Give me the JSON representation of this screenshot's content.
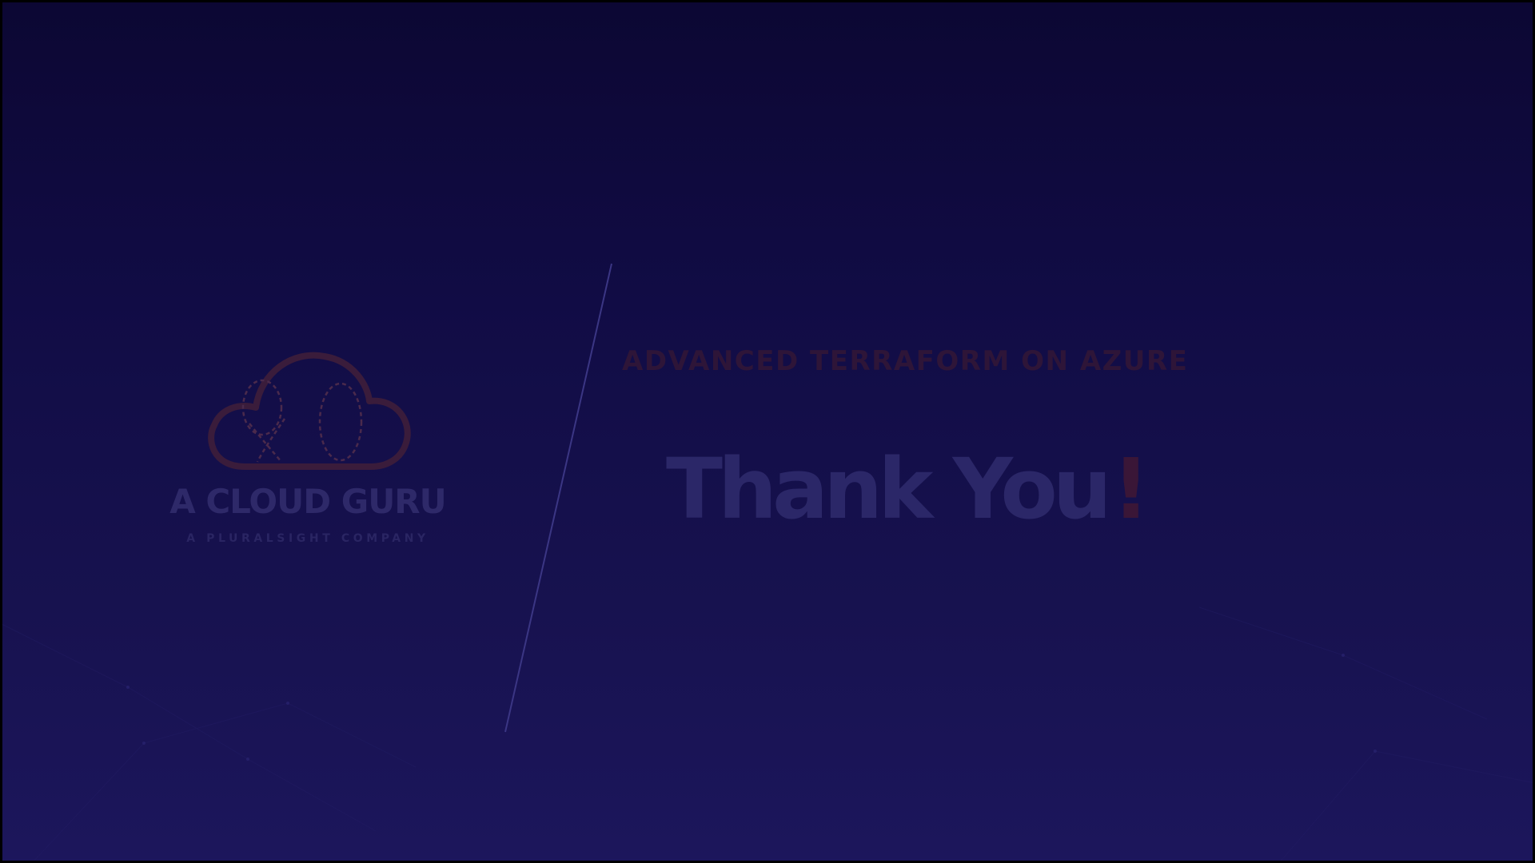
{
  "slide": {
    "course_title": "ADVANCED TERRAFORM ON AZURE",
    "message": "Thank You",
    "message_punctuation": "!"
  },
  "logo": {
    "icon": "cloud-logo-icon",
    "name": "A CLOUD GURU",
    "tagline": "A PLURALSIGHT COMPANY"
  },
  "colors": {
    "background_top": "#0c0733",
    "background_bottom": "#1c165c",
    "accent_orange_dim": "#3a1c3b",
    "text_dim_purple": "#2b2768"
  }
}
